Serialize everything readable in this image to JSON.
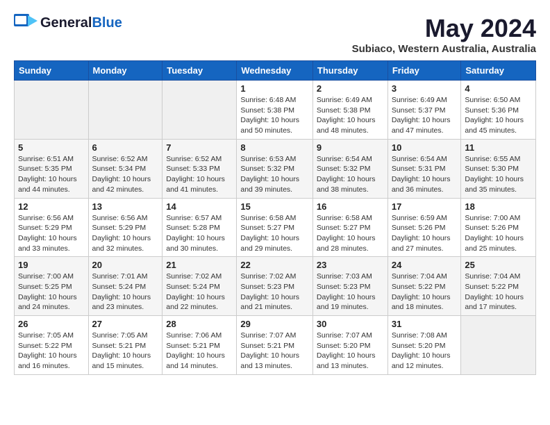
{
  "header": {
    "logo_line1": "General",
    "logo_line2": "Blue",
    "month": "May 2024",
    "location": "Subiaco, Western Australia, Australia"
  },
  "weekdays": [
    "Sunday",
    "Monday",
    "Tuesday",
    "Wednesday",
    "Thursday",
    "Friday",
    "Saturday"
  ],
  "weeks": [
    [
      {
        "day": "",
        "info": ""
      },
      {
        "day": "",
        "info": ""
      },
      {
        "day": "",
        "info": ""
      },
      {
        "day": "1",
        "info": "Sunrise: 6:48 AM\nSunset: 5:38 PM\nDaylight: 10 hours\nand 50 minutes."
      },
      {
        "day": "2",
        "info": "Sunrise: 6:49 AM\nSunset: 5:38 PM\nDaylight: 10 hours\nand 48 minutes."
      },
      {
        "day": "3",
        "info": "Sunrise: 6:49 AM\nSunset: 5:37 PM\nDaylight: 10 hours\nand 47 minutes."
      },
      {
        "day": "4",
        "info": "Sunrise: 6:50 AM\nSunset: 5:36 PM\nDaylight: 10 hours\nand 45 minutes."
      }
    ],
    [
      {
        "day": "5",
        "info": "Sunrise: 6:51 AM\nSunset: 5:35 PM\nDaylight: 10 hours\nand 44 minutes."
      },
      {
        "day": "6",
        "info": "Sunrise: 6:52 AM\nSunset: 5:34 PM\nDaylight: 10 hours\nand 42 minutes."
      },
      {
        "day": "7",
        "info": "Sunrise: 6:52 AM\nSunset: 5:33 PM\nDaylight: 10 hours\nand 41 minutes."
      },
      {
        "day": "8",
        "info": "Sunrise: 6:53 AM\nSunset: 5:32 PM\nDaylight: 10 hours\nand 39 minutes."
      },
      {
        "day": "9",
        "info": "Sunrise: 6:54 AM\nSunset: 5:32 PM\nDaylight: 10 hours\nand 38 minutes."
      },
      {
        "day": "10",
        "info": "Sunrise: 6:54 AM\nSunset: 5:31 PM\nDaylight: 10 hours\nand 36 minutes."
      },
      {
        "day": "11",
        "info": "Sunrise: 6:55 AM\nSunset: 5:30 PM\nDaylight: 10 hours\nand 35 minutes."
      }
    ],
    [
      {
        "day": "12",
        "info": "Sunrise: 6:56 AM\nSunset: 5:29 PM\nDaylight: 10 hours\nand 33 minutes."
      },
      {
        "day": "13",
        "info": "Sunrise: 6:56 AM\nSunset: 5:29 PM\nDaylight: 10 hours\nand 32 minutes."
      },
      {
        "day": "14",
        "info": "Sunrise: 6:57 AM\nSunset: 5:28 PM\nDaylight: 10 hours\nand 30 minutes."
      },
      {
        "day": "15",
        "info": "Sunrise: 6:58 AM\nSunset: 5:27 PM\nDaylight: 10 hours\nand 29 minutes."
      },
      {
        "day": "16",
        "info": "Sunrise: 6:58 AM\nSunset: 5:27 PM\nDaylight: 10 hours\nand 28 minutes."
      },
      {
        "day": "17",
        "info": "Sunrise: 6:59 AM\nSunset: 5:26 PM\nDaylight: 10 hours\nand 27 minutes."
      },
      {
        "day": "18",
        "info": "Sunrise: 7:00 AM\nSunset: 5:26 PM\nDaylight: 10 hours\nand 25 minutes."
      }
    ],
    [
      {
        "day": "19",
        "info": "Sunrise: 7:00 AM\nSunset: 5:25 PM\nDaylight: 10 hours\nand 24 minutes."
      },
      {
        "day": "20",
        "info": "Sunrise: 7:01 AM\nSunset: 5:24 PM\nDaylight: 10 hours\nand 23 minutes."
      },
      {
        "day": "21",
        "info": "Sunrise: 7:02 AM\nSunset: 5:24 PM\nDaylight: 10 hours\nand 22 minutes."
      },
      {
        "day": "22",
        "info": "Sunrise: 7:02 AM\nSunset: 5:23 PM\nDaylight: 10 hours\nand 21 minutes."
      },
      {
        "day": "23",
        "info": "Sunrise: 7:03 AM\nSunset: 5:23 PM\nDaylight: 10 hours\nand 19 minutes."
      },
      {
        "day": "24",
        "info": "Sunrise: 7:04 AM\nSunset: 5:22 PM\nDaylight: 10 hours\nand 18 minutes."
      },
      {
        "day": "25",
        "info": "Sunrise: 7:04 AM\nSunset: 5:22 PM\nDaylight: 10 hours\nand 17 minutes."
      }
    ],
    [
      {
        "day": "26",
        "info": "Sunrise: 7:05 AM\nSunset: 5:22 PM\nDaylight: 10 hours\nand 16 minutes."
      },
      {
        "day": "27",
        "info": "Sunrise: 7:05 AM\nSunset: 5:21 PM\nDaylight: 10 hours\nand 15 minutes."
      },
      {
        "day": "28",
        "info": "Sunrise: 7:06 AM\nSunset: 5:21 PM\nDaylight: 10 hours\nand 14 minutes."
      },
      {
        "day": "29",
        "info": "Sunrise: 7:07 AM\nSunset: 5:21 PM\nDaylight: 10 hours\nand 13 minutes."
      },
      {
        "day": "30",
        "info": "Sunrise: 7:07 AM\nSunset: 5:20 PM\nDaylight: 10 hours\nand 13 minutes."
      },
      {
        "day": "31",
        "info": "Sunrise: 7:08 AM\nSunset: 5:20 PM\nDaylight: 10 hours\nand 12 minutes."
      },
      {
        "day": "",
        "info": ""
      }
    ]
  ]
}
